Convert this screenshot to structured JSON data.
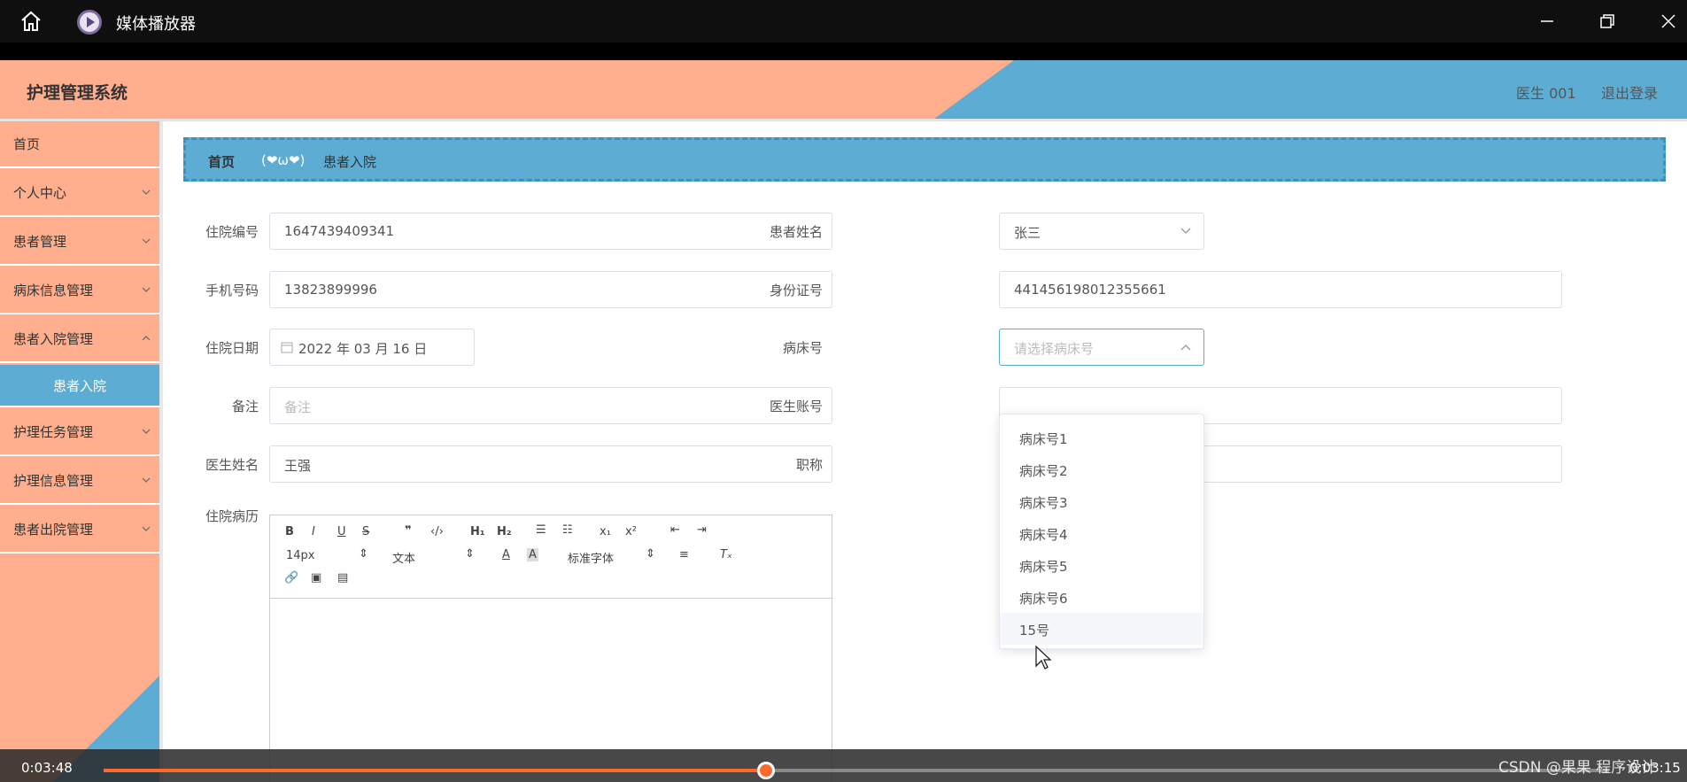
{
  "player": {
    "title": "媒体播放器",
    "current_time": "0:03:48",
    "total_time": "0:03:15",
    "progress_fraction": 0.44,
    "watermark": "CSDN @果果 程序设计"
  },
  "header": {
    "system_title": "护理管理系统",
    "user": "医生 001",
    "logout": "退出登录"
  },
  "sidebar": {
    "items": [
      {
        "label": "首页"
      },
      {
        "label": "个人中心"
      },
      {
        "label": "患者管理"
      },
      {
        "label": "病床信息管理"
      },
      {
        "label": "患者入院管理"
      },
      {
        "label": "患者入院"
      },
      {
        "label": "护理任务管理"
      },
      {
        "label": "护理信息管理"
      },
      {
        "label": "患者出院管理"
      }
    ]
  },
  "breadcrumb": {
    "home": "首页",
    "separator": "(❤ω❤)",
    "current": "患者入院"
  },
  "form": {
    "admission_no": {
      "label": "住院编号",
      "value": "1647439409341"
    },
    "patient_name": {
      "label": "患者姓名",
      "value": "张三"
    },
    "phone": {
      "label": "手机号码",
      "value": "13823899996"
    },
    "id_card": {
      "label": "身份证号",
      "value": "441456198012355661"
    },
    "admission_date": {
      "label": "住院日期",
      "value": "2022 年 03 月 16 日"
    },
    "bed_no": {
      "label": "病床号",
      "placeholder": "请选择病床号"
    },
    "remark": {
      "label": "备注",
      "placeholder": "备注"
    },
    "doctor_account": {
      "label": "医生账号",
      "value": ""
    },
    "doctor_name": {
      "label": "医生姓名",
      "value": "王强"
    },
    "title_field": {
      "label": "职称",
      "value": ""
    },
    "history": {
      "label": "住院病历"
    }
  },
  "editor": {
    "font_size": "14px",
    "text_style": "文本",
    "font_family": "标准字体"
  },
  "bed_dropdown": {
    "options": [
      "病床号1",
      "病床号2",
      "病床号3",
      "病床号4",
      "病床号5",
      "病床号6",
      "15号"
    ],
    "hovered": "15号"
  },
  "colors": {
    "salmon": "#ffaf8e",
    "blue": "#5dacd3",
    "accent_orange": "#ff6a2a"
  }
}
